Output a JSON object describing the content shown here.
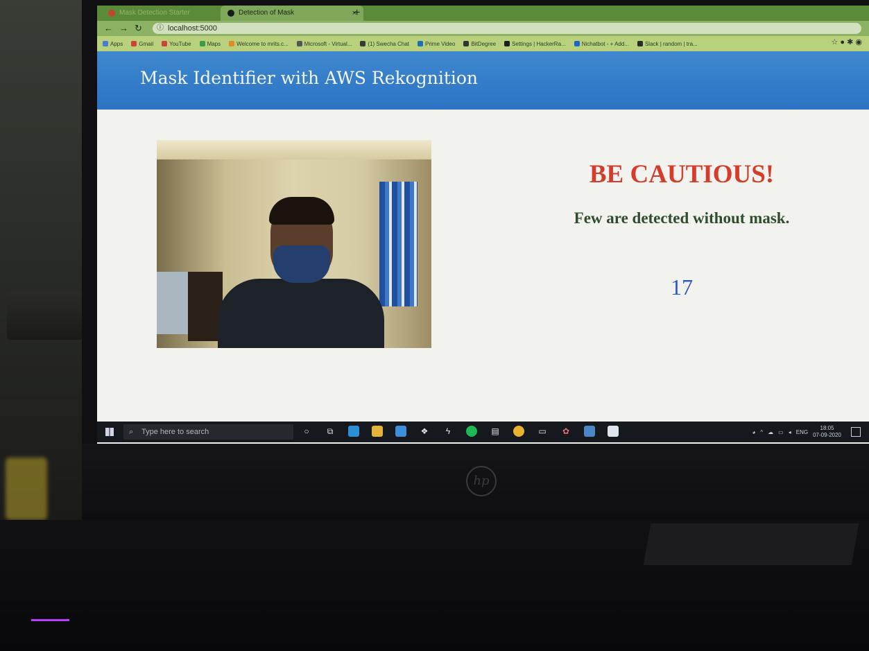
{
  "browser": {
    "tabs": [
      {
        "label": "Mask Detection Starter",
        "active": false
      },
      {
        "label": "Detection of Mask",
        "active": true
      }
    ],
    "new_tab_symbol": "+",
    "url": "localhost:5000",
    "bookmarks": [
      {
        "label": "Apps",
        "color": "#4a7bd0"
      },
      {
        "label": "Gmail",
        "color": "#d0413a"
      },
      {
        "label": "YouTube",
        "color": "#d0413a"
      },
      {
        "label": "Maps",
        "color": "#3c9a4a"
      },
      {
        "label": "Welcome to mrits.c...",
        "color": "#e08a2a"
      },
      {
        "label": "Microsoft - Virtual...",
        "color": "#555555"
      },
      {
        "label": "(1) Swecha Chat",
        "color": "#3a3a3a"
      },
      {
        "label": "Prime Video",
        "color": "#1f6fb8"
      },
      {
        "label": "BitDegree",
        "color": "#333333"
      },
      {
        "label": "Settings | HackerRa...",
        "color": "#1d1d1d"
      },
      {
        "label": "Nichatbot - + Add...",
        "color": "#1b66c9"
      },
      {
        "label": "Slack | random | tra...",
        "color": "#2b2b2b"
      }
    ]
  },
  "site": {
    "title": "Mask Identifier with AWS Rekognition",
    "alert_heading": "BE CAUTIOUS!",
    "alert_message": "Few are detected without mask.",
    "count": "17"
  },
  "taskbar": {
    "search_placeholder": "Type here to search",
    "language": "ENG",
    "time": "18:05",
    "date": "07-09-2020"
  },
  "colors": {
    "header": "#2b73c4",
    "alert": "#d43c2c",
    "message": "#2e4d2e",
    "count": "#2b55c8"
  }
}
